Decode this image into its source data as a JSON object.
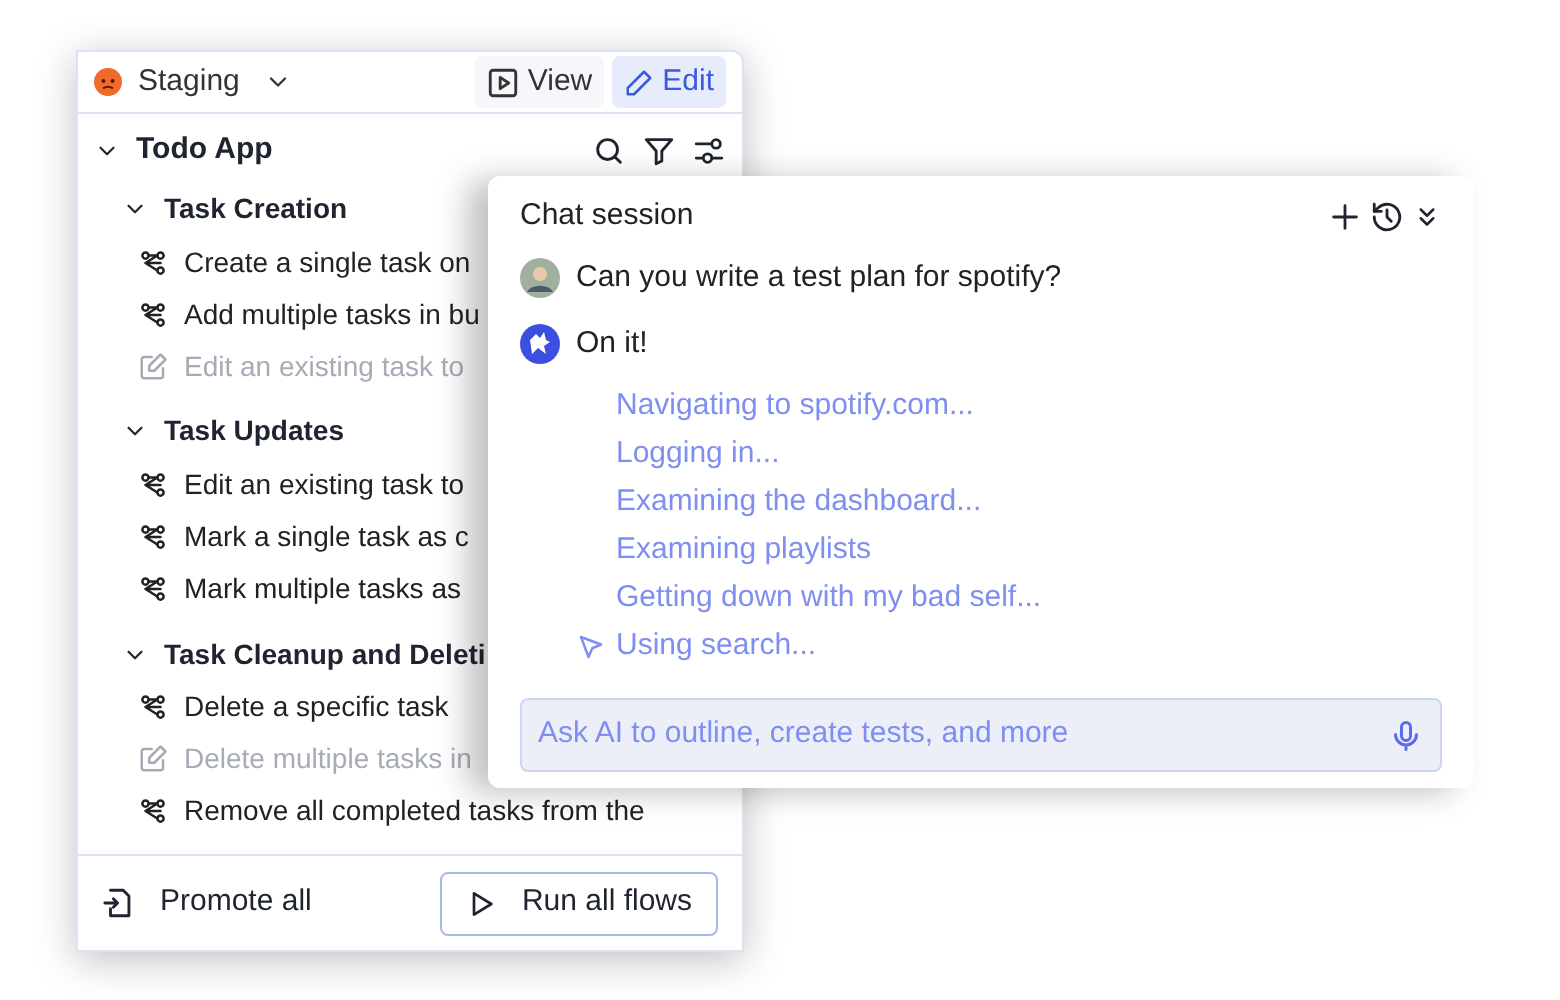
{
  "environment": {
    "label": "Staging"
  },
  "modes": [
    {
      "label": "View",
      "selected": false
    },
    {
      "label": "Edit",
      "selected": true
    }
  ],
  "tree": {
    "title": "Todo App",
    "expanded": true,
    "groups": [
      {
        "title": "Task Creation",
        "expanded": true,
        "items": [
          {
            "label": "Create a single task on",
            "kind": "flow"
          },
          {
            "label": "Add multiple tasks in bu",
            "kind": "flow"
          },
          {
            "label": "Edit an existing task to",
            "kind": "draft"
          }
        ]
      },
      {
        "title": "Task Updates",
        "expanded": true,
        "items": [
          {
            "label": "Edit an existing task to",
            "kind": "flow"
          },
          {
            "label": "Mark a single task as c",
            "kind": "flow"
          },
          {
            "label": "Mark multiple tasks as",
            "kind": "flow"
          }
        ]
      },
      {
        "title": "Task Cleanup and Deleti",
        "expanded": true,
        "items": [
          {
            "label": "Delete a specific task",
            "kind": "flow"
          },
          {
            "label": "Delete multiple tasks in",
            "kind": "draft"
          },
          {
            "label": "Remove all completed tasks from the",
            "kind": "flow"
          }
        ]
      }
    ]
  },
  "footer": {
    "promote": "Promote all",
    "run": "Run all flows"
  },
  "chat": {
    "title": "Chat session",
    "messages": [
      {
        "kind": "user",
        "text": "Can you write a test plan for spotify?"
      },
      {
        "kind": "bot",
        "text": "On it!"
      }
    ],
    "steps": [
      {
        "text": "Navigating to spotify.com...",
        "kind": "step"
      },
      {
        "text": "Logging in...",
        "kind": "step"
      },
      {
        "text": "Examining the dashboard...",
        "kind": "step"
      },
      {
        "text": "Examining playlists",
        "kind": "step"
      },
      {
        "text": "Getting down with my bad self...",
        "kind": "step"
      },
      {
        "text": "Using search...",
        "kind": "action"
      }
    ],
    "input": {
      "placeholder": "Ask AI to outline, create tests, and more"
    }
  }
}
